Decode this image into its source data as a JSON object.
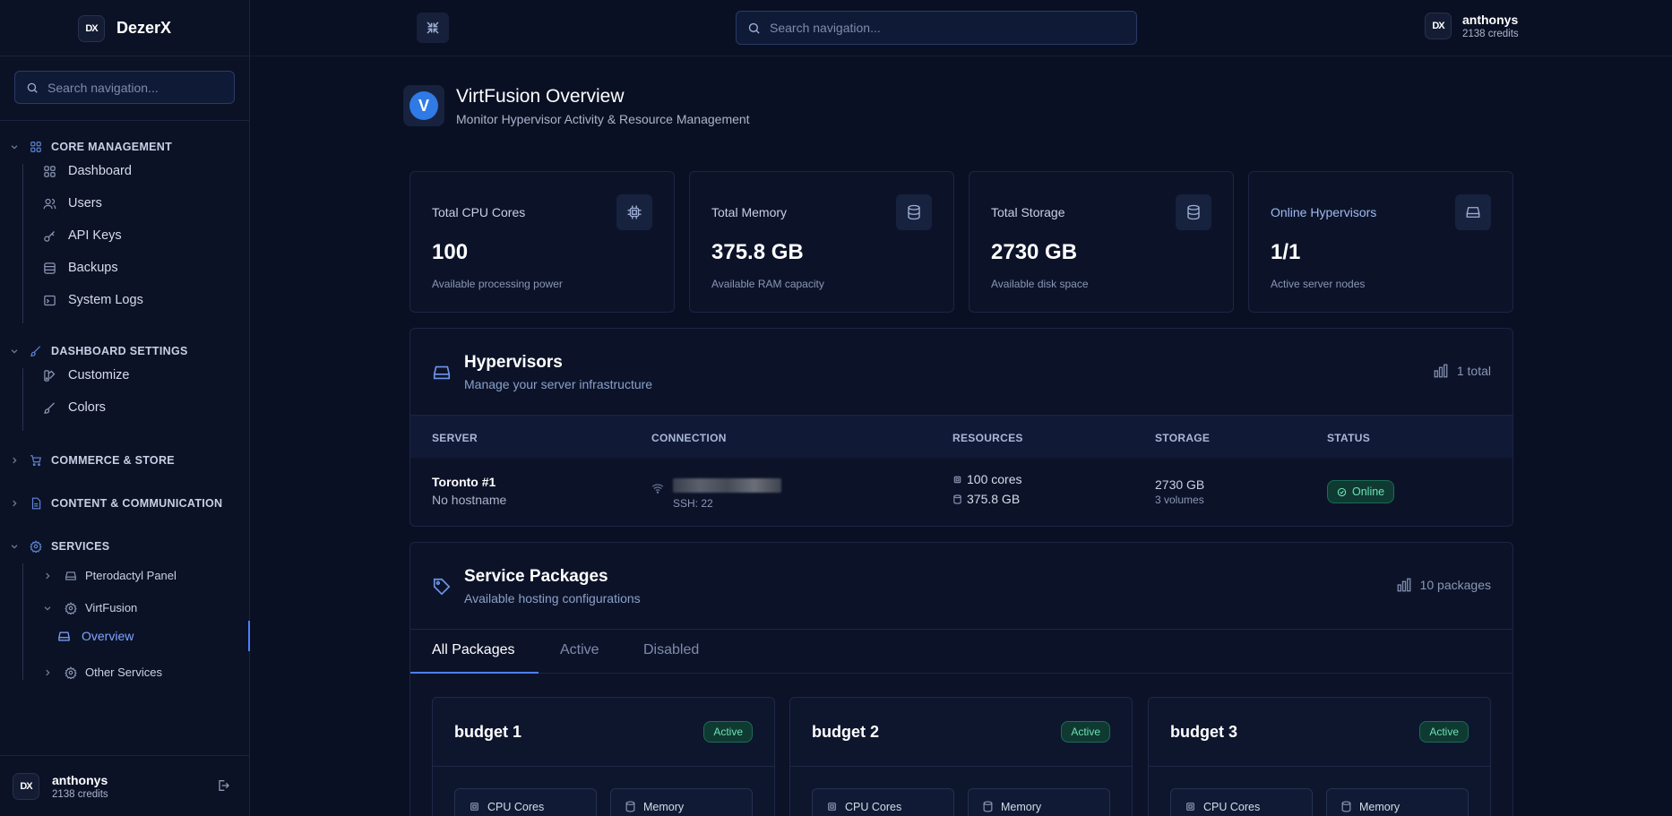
{
  "brand": {
    "name": "DezerX",
    "logo_text": "DX"
  },
  "search": {
    "placeholder": "Search navigation..."
  },
  "user": {
    "name": "anthonys",
    "credits": "2138 credits"
  },
  "sidebar": {
    "sections": [
      {
        "label": "CORE MANAGEMENT",
        "icon": "grid-icon",
        "expanded": true
      },
      {
        "label": "DASHBOARD SETTINGS",
        "icon": "brush-icon",
        "expanded": true
      },
      {
        "label": "COMMERCE & STORE",
        "icon": "cart-icon",
        "expanded": false
      },
      {
        "label": "CONTENT & COMMUNICATION",
        "icon": "document-icon",
        "expanded": false
      },
      {
        "label": "SERVICES",
        "icon": "gear-icon",
        "expanded": true
      }
    ],
    "core_items": [
      "Dashboard",
      "Users",
      "API Keys",
      "Backups",
      "System Logs"
    ],
    "settings_items": [
      "Customize",
      "Colors"
    ],
    "services_items": [
      "Pterodactyl Panel",
      "VirtFusion",
      "Overview",
      "Other Services"
    ]
  },
  "page": {
    "title": "VirtFusion Overview",
    "subtitle": "Monitor Hypervisor Activity & Resource Management"
  },
  "stats": [
    {
      "label": "Total CPU Cores",
      "value": "100",
      "desc": "Available processing power",
      "icon": "cpu-icon"
    },
    {
      "label": "Total Memory",
      "value": "375.8 GB",
      "desc": "Available RAM capacity",
      "icon": "database-icon"
    },
    {
      "label": "Total Storage",
      "value": "2730 GB",
      "desc": "Available disk space",
      "icon": "database-icon"
    },
    {
      "label": "Online Hypervisors",
      "value": "1/1",
      "desc": "Active server nodes",
      "icon": "server-icon"
    }
  ],
  "hypervisors": {
    "title": "Hypervisors",
    "subtitle": "Manage your server infrastructure",
    "count": "1 total",
    "columns": [
      "SERVER",
      "CONNECTION",
      "RESOURCES",
      "STORAGE",
      "STATUS"
    ],
    "rows": [
      {
        "server": "Toronto #1",
        "hostname": "No hostname",
        "ssh": "SSH: 22",
        "cores": "100 cores",
        "memory": "375.8 GB",
        "storage": "2730 GB",
        "volumes": "3 volumes",
        "status": "Online"
      }
    ]
  },
  "packages": {
    "title": "Service Packages",
    "subtitle": "Available hosting configurations",
    "count": "10 packages",
    "tabs": [
      "All Packages",
      "Active",
      "Disabled"
    ],
    "cards": [
      {
        "name": "budget 1",
        "status": "Active",
        "spec1": "CPU Cores",
        "spec2": "Memory"
      },
      {
        "name": "budget 2",
        "status": "Active",
        "spec1": "CPU Cores",
        "spec2": "Memory"
      },
      {
        "name": "budget 3",
        "status": "Active",
        "spec1": "CPU Cores",
        "spec2": "Memory"
      }
    ]
  },
  "colors": {
    "accent": "#4e7dff",
    "online": "#6fe0b4",
    "background": "#0a1024"
  }
}
